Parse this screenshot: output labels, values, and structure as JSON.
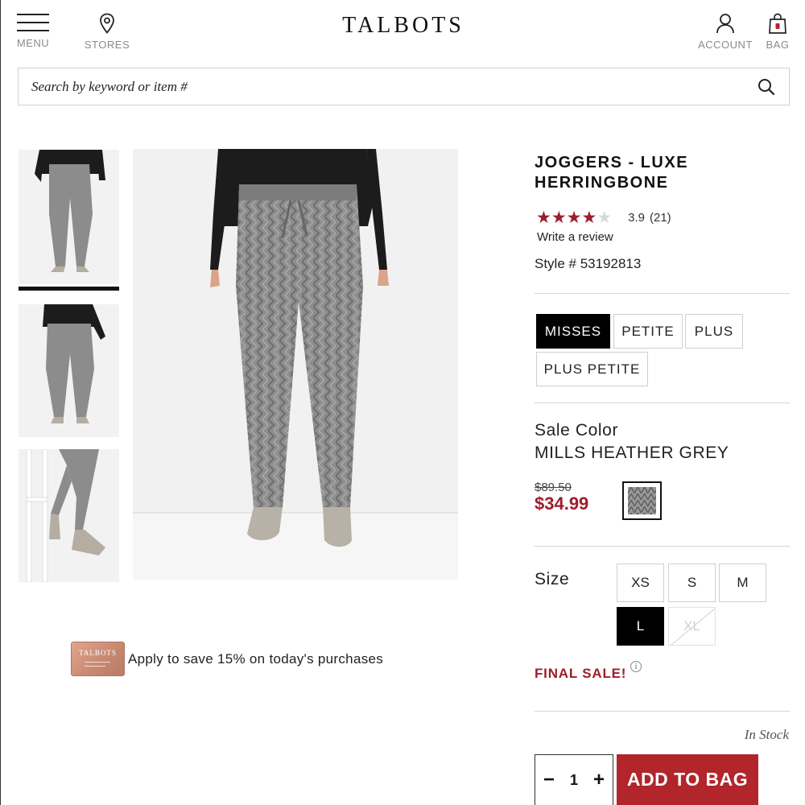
{
  "header": {
    "brand": "TALBOTS",
    "menu_label": "MENU",
    "stores_label": "STORES",
    "account_label": "ACCOUNT",
    "bag_label": "BAG"
  },
  "search": {
    "placeholder": "Search by keyword or item #",
    "value": ""
  },
  "product": {
    "title": "JOGGERS - LUXE HERRINGBONE",
    "rating": {
      "stars_filled": 4,
      "stars_total": 5,
      "stars_full": "★★★★",
      "stars_empty": "★",
      "score": "3.9",
      "count": "(21)",
      "write_review": "Write a review"
    },
    "style_number": "Style # 53192813",
    "fits": [
      {
        "label": "MISSES",
        "selected": true
      },
      {
        "label": "PETITE",
        "selected": false
      },
      {
        "label": "PLUS",
        "selected": false
      },
      {
        "label": "PLUS PETITE",
        "selected": false
      }
    ],
    "color": {
      "label": "Sale Color",
      "name": "MILLS HEATHER GREY"
    },
    "price": {
      "original": "$89.50",
      "sale": "$34.99"
    },
    "size_label": "Size",
    "sizes": [
      {
        "label": "XS",
        "state": "available"
      },
      {
        "label": "S",
        "state": "available"
      },
      {
        "label": "M",
        "state": "available"
      },
      {
        "label": "L",
        "state": "selected"
      },
      {
        "label": "XL",
        "state": "unavailable"
      }
    ],
    "final_sale": "FINAL SALE!",
    "info_glyph": "i",
    "stock": "In Stock",
    "quantity": {
      "minus": "−",
      "value": "1",
      "plus": "+"
    },
    "add_to_bag": "ADD TO BAG"
  },
  "gallery": {
    "selected_thumb": 0
  },
  "promo": {
    "card_brand": "TALBOTS",
    "text": "Apply to save 15% on today's purchases"
  },
  "colors": {
    "sale_red": "#9e1d2b",
    "button_red": "#b2252b",
    "selected_black": "#000000",
    "star_filled": "#9e1d2b",
    "star_empty": "#d9d9d9"
  }
}
